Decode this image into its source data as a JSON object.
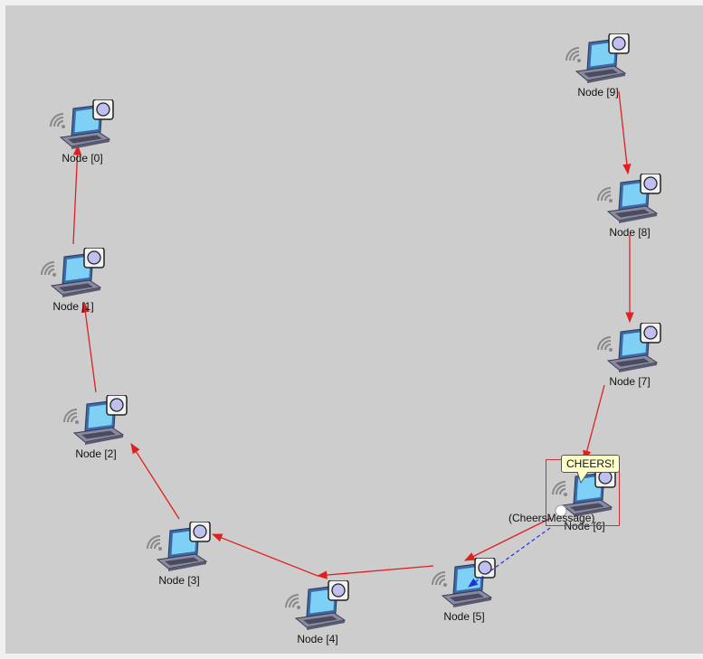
{
  "simulation": {
    "nodes": [
      {
        "id": 0,
        "label": "Node [0]"
      },
      {
        "id": 1,
        "label": "Node [1]"
      },
      {
        "id": 2,
        "label": "Node [2]"
      },
      {
        "id": 3,
        "label": "Node [3]"
      },
      {
        "id": 4,
        "label": "Node [4]"
      },
      {
        "id": 5,
        "label": "Node [5]"
      },
      {
        "id": 6,
        "label": "Node [6]"
      },
      {
        "id": 7,
        "label": "Node [7]"
      },
      {
        "id": 8,
        "label": "Node [8]"
      },
      {
        "id": 9,
        "label": "Node [9]"
      }
    ],
    "bubble_text": "CHEERS!",
    "message_label": "(CheersMessage)",
    "colors": {
      "canvas": "#cdcdcd",
      "link": "#e02020",
      "message_path": "#2030e0",
      "selection": "#d03030",
      "bubble": "#ffffc8"
    }
  }
}
